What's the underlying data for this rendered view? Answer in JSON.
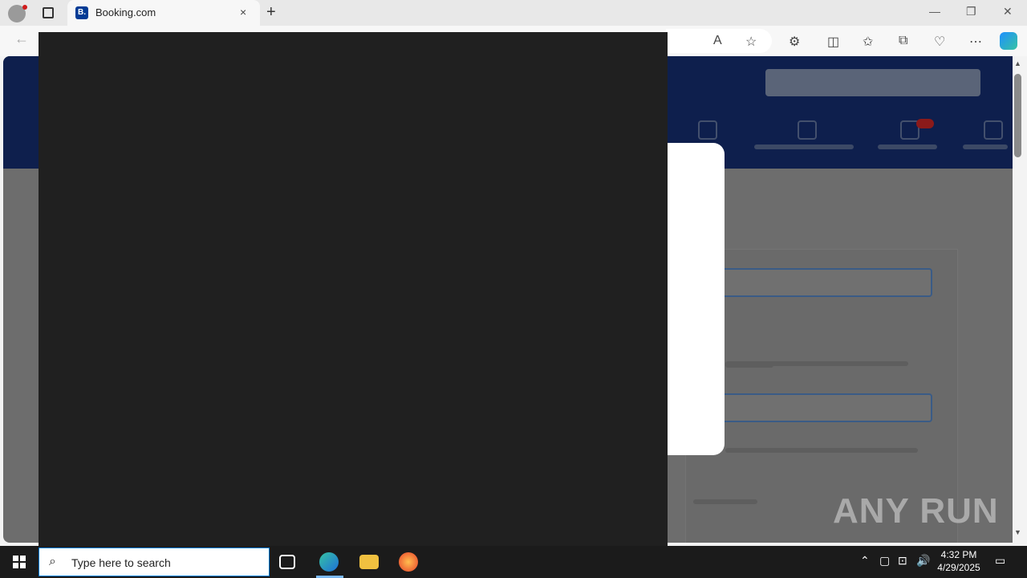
{
  "browser": {
    "tab_title": "Booking.com",
    "favicon_letter": "B.",
    "new_tab_label": "+",
    "close_tab_label": "×"
  },
  "page": {
    "watermark": "ANY RUN"
  },
  "taskbar": {
    "search_placeholder": "Type here to search",
    "time": "4:32 PM",
    "date": "4/29/2025"
  }
}
